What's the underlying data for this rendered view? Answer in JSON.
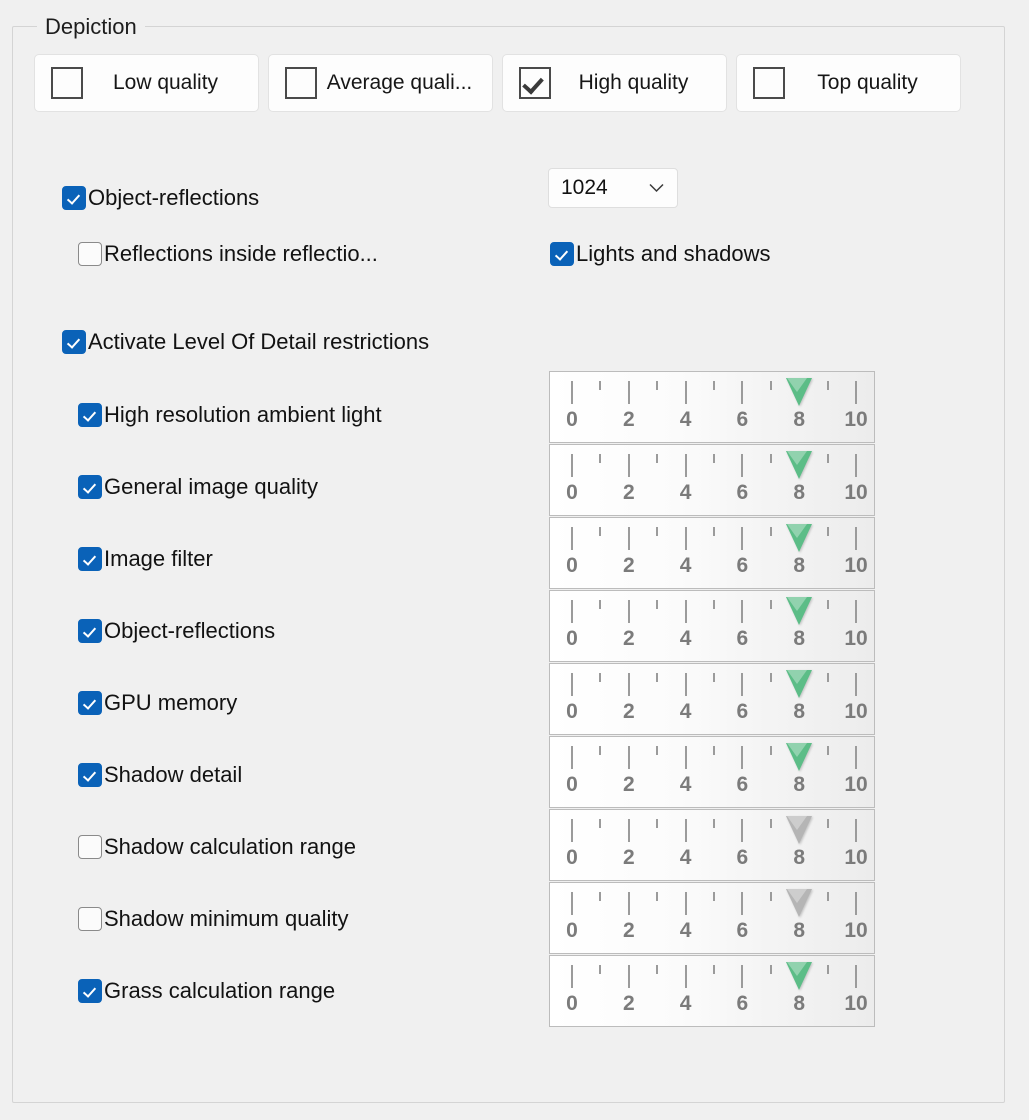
{
  "group": {
    "title": "Depiction"
  },
  "quality_buttons": [
    {
      "label": "Low quality",
      "checked": false
    },
    {
      "label": "Average quali...",
      "checked": false
    },
    {
      "label": "High quality",
      "checked": true
    },
    {
      "label": "Top quality",
      "checked": false
    }
  ],
  "options": {
    "object_reflections": {
      "label": "Object-reflections",
      "checked": true
    },
    "reflections_inside": {
      "label": "Reflections inside reflectio...",
      "checked": false
    },
    "lights_and_shadows": {
      "label": "Lights and shadows",
      "checked": true
    },
    "activate_lod": {
      "label": "Activate Level Of Detail restrictions",
      "checked": true
    }
  },
  "resolution_combo": {
    "value": "1024",
    "arrow_icon": "chevron-down-icon"
  },
  "lod_rows": [
    {
      "label": "High resolution ambient light",
      "checked": true,
      "value": 8,
      "thumb": "green"
    },
    {
      "label": "General image quality",
      "checked": true,
      "value": 8,
      "thumb": "green"
    },
    {
      "label": "Image filter",
      "checked": true,
      "value": 8,
      "thumb": "green"
    },
    {
      "label": "Object-reflections",
      "checked": true,
      "value": 8,
      "thumb": "green"
    },
    {
      "label": "GPU memory",
      "checked": true,
      "value": 8,
      "thumb": "green"
    },
    {
      "label": "Shadow detail",
      "checked": true,
      "value": 8,
      "thumb": "green"
    },
    {
      "label": "Shadow calculation range",
      "checked": false,
      "value": 8,
      "thumb": "gray"
    },
    {
      "label": "Shadow minimum quality",
      "checked": false,
      "value": 8,
      "thumb": "gray"
    },
    {
      "label": "Grass calculation range",
      "checked": true,
      "value": 8,
      "thumb": "green"
    }
  ],
  "slider_scale": {
    "min": 0,
    "max": 10,
    "major_ticks": [
      0,
      2,
      4,
      6,
      8,
      10
    ],
    "major_labels": [
      "0",
      "2",
      "4",
      "6",
      "8",
      "10"
    ],
    "minor_ticks": [
      1,
      3,
      5,
      7,
      9
    ]
  },
  "colors": {
    "accent_checkbox": "#0a62b8",
    "thumb_active": "#5cbd87",
    "thumb_disabled": "#b5b5b5",
    "page_background": "#f0f0f0",
    "groupbox_border": "#d4d4d4"
  }
}
